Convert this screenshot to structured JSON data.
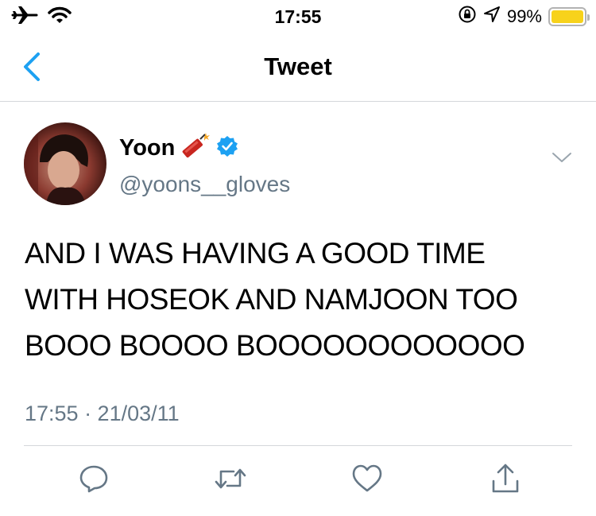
{
  "status_bar": {
    "time": "17:55",
    "battery_percent_text": "99%",
    "battery_level": 0.99,
    "icons": [
      "airplane-mode-icon",
      "wifi-icon",
      "orientation-lock-icon",
      "location-icon",
      "battery-icon"
    ]
  },
  "nav": {
    "title": "Tweet",
    "back_icon": "chevron-left-icon"
  },
  "tweet": {
    "display_name": "Yoon",
    "handle": "@yoons__gloves",
    "name_emoji": "firecracker-emoji",
    "verified": true,
    "text_lines": [
      "AND I WAS HAVING A GOOD TIME",
      "WITH HOSEOK AND NAMJOON TOO",
      "BOOO BOOOO BOOOOOOOOOOOO"
    ],
    "timestamp": "17:55 · 21/03/11"
  },
  "actions": [
    "reply-icon",
    "retweet-icon",
    "like-icon",
    "share-icon"
  ],
  "colors": {
    "accent": "#1da1f2",
    "secondary_text": "#657786",
    "divider": "#d4d7da",
    "battery": "#f7d21b"
  }
}
